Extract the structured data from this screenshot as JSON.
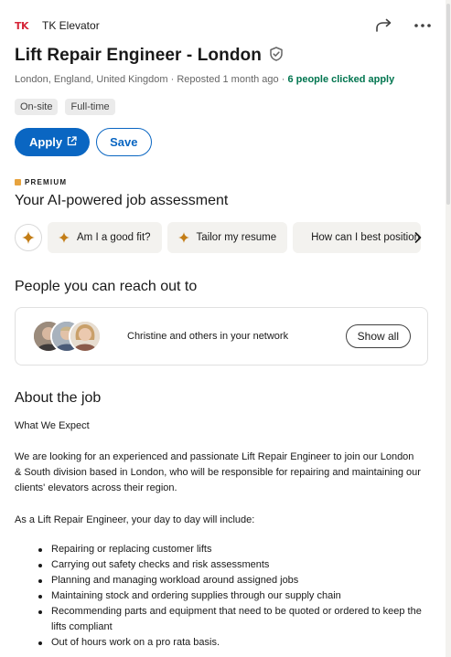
{
  "company": {
    "logo_text": "TK",
    "name": "TK Elevator"
  },
  "header": {
    "share_icon": "share-arrow-icon",
    "more_icon": "more-dots-icon"
  },
  "job": {
    "title": "Lift Repair Engineer - London",
    "verified_icon": "verified-shield-icon",
    "location": "London, England, United Kingdom",
    "separator": " · ",
    "posted": "Reposted 1 month ago",
    "clicked": "6 people clicked apply",
    "chips": [
      "On-site",
      "Full-time"
    ]
  },
  "actions": {
    "apply_label": "Apply",
    "save_label": "Save"
  },
  "premium": {
    "label": "PREMIUM",
    "heading": "Your AI-powered job assessment",
    "pills": [
      "Am I a good fit?",
      "Tailor my resume",
      "How can I best position myself"
    ]
  },
  "people": {
    "heading": "People you can reach out to",
    "text": "Christine and others in your network",
    "show_all_label": "Show all"
  },
  "about": {
    "heading": "About the job",
    "subheading": "What We Expect",
    "paragraph1": "We are looking for an experienced and passionate Lift Repair Engineer to join our London & South division based in London, who will be responsible for repairing and maintaining our clients' elevators across their region.",
    "paragraph2": "As a Lift Repair Engineer, your day to day will include:",
    "bullets": [
      "Repairing or replacing customer lifts",
      "Carrying out safety checks and risk assessments",
      "Planning and managing workload around assigned jobs",
      "Maintaining stock and ordering supplies through our supply chain",
      "Recommending parts and equipment that need to be quoted or ordered to keep the lifts compliant",
      "Out of hours work on a pro rata basis."
    ]
  },
  "colors": {
    "brand_blue": "#0a66c2",
    "green": "#01754f",
    "premium_gold": "#e7a33e",
    "logo_red": "#d6283a"
  }
}
